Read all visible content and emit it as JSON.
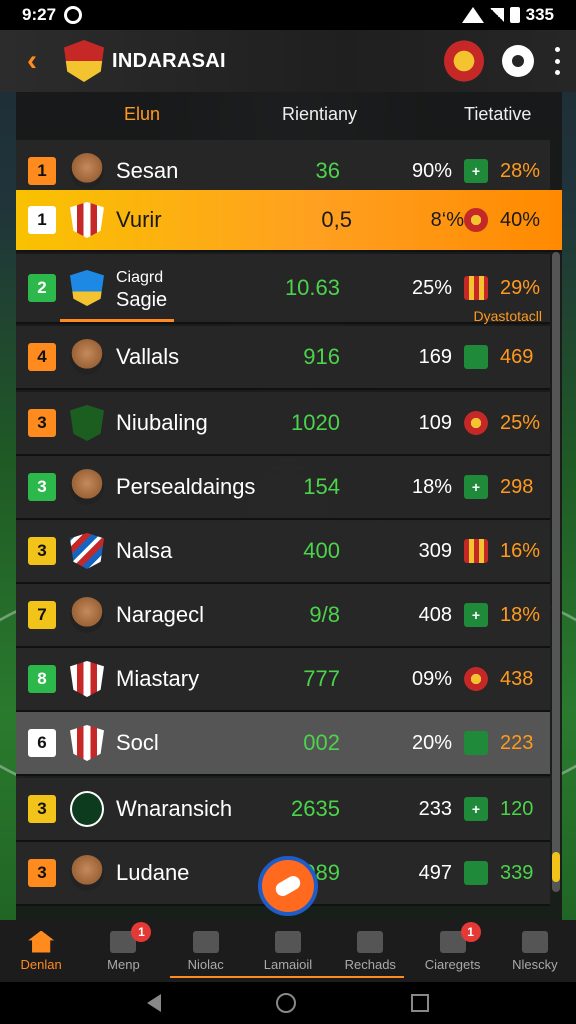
{
  "status_bar": {
    "time": "9:27",
    "battery": "335"
  },
  "header": {
    "title": "INDARASAI"
  },
  "table": {
    "columns": {
      "club": "Elun",
      "mid": "Rientiany",
      "right": "Tietative"
    },
    "note": "Dyastotacll",
    "rows": [
      {
        "pos": "1",
        "name": "Sesan",
        "name2": "",
        "val1": "36",
        "val2": "90%",
        "icon": "+",
        "val3": "28%"
      },
      {
        "pos": "1",
        "name": "Vurir",
        "name2": "",
        "val1": "0,5",
        "val2": "8‘%",
        "icon": "",
        "val3": "40%"
      },
      {
        "pos": "2",
        "name": "Ciagrd",
        "name2": "Sagie",
        "val1": "10.63",
        "val2": "25%",
        "icon": "",
        "val3": "29%"
      },
      {
        "pos": "4",
        "name": "Vallals",
        "name2": "",
        "val1": "916",
        "val2": "169",
        "icon": "",
        "val3": "469"
      },
      {
        "pos": "3",
        "name": "Niubaling",
        "name2": "",
        "val1": "1020",
        "val2": "109",
        "icon": "",
        "val3": "25%"
      },
      {
        "pos": "3",
        "name": "Persealdaings",
        "name2": "",
        "val1": "154",
        "val2": "18%",
        "icon": "+",
        "val3": "298"
      },
      {
        "pos": "3",
        "name": "Nalsa",
        "name2": "",
        "val1": "400",
        "val2": "309",
        "icon": "",
        "val3": "16%"
      },
      {
        "pos": "7",
        "name": "Naragecl",
        "name2": "",
        "val1": "9/8",
        "val2": "408",
        "icon": "+",
        "val3": "18%"
      },
      {
        "pos": "8",
        "name": "Miastary",
        "name2": "",
        "val1": "777",
        "val2": "09%",
        "icon": "",
        "val3": "438"
      },
      {
        "pos": "6",
        "name": "Socl",
        "name2": "",
        "val1": "002",
        "val2": "20%",
        "icon": "",
        "val3": "223"
      },
      {
        "pos": "3",
        "name": "Wnaransich",
        "name2": "",
        "val1": "2635",
        "val2": "233",
        "icon": "+",
        "val3": "120"
      },
      {
        "pos": "3",
        "name": "Ludane",
        "name2": "",
        "val1": "089",
        "val2": "497",
        "icon": "",
        "val3": "339"
      }
    ]
  },
  "nav": {
    "items": [
      {
        "label": "Denlan",
        "badge": ""
      },
      {
        "label": "Menp",
        "badge": "1"
      },
      {
        "label": "Niolac",
        "badge": ""
      },
      {
        "label": "Lamaioil",
        "badge": ""
      },
      {
        "label": "Rechads",
        "badge": ""
      },
      {
        "label": "Ciaregets",
        "badge": "1"
      },
      {
        "label": "Nlescky",
        "badge": ""
      }
    ]
  }
}
